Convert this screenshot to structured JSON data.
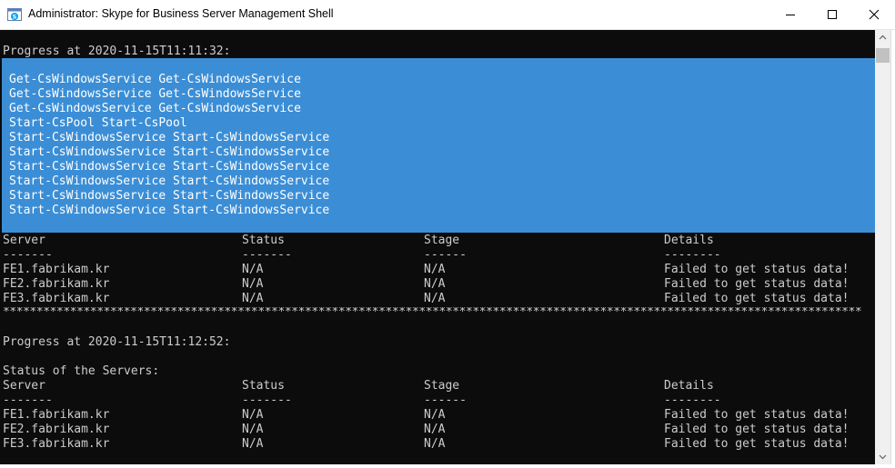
{
  "window": {
    "title": "Administrator: Skype for Business Server Management Shell",
    "icon": "skype-powershell-icon",
    "controls": {
      "minimize": "minimize-icon",
      "maximize": "maximize-icon",
      "close": "close-icon"
    }
  },
  "colors": {
    "console_bg": "#0c0c0c",
    "console_text": "#cccccc",
    "selection_bg": "#3b8ed6",
    "selection_text": "#ffffff"
  },
  "console": {
    "progress1": "Progress at 2020-11-15T11:11:32:",
    "selected_lines": [
      "Get-CsWindowsService Get-CsWindowsService",
      "Get-CsWindowsService Get-CsWindowsService",
      "Get-CsWindowsService Get-CsWindowsService",
      "Start-CsPool Start-CsPool",
      "Start-CsWindowsService Start-CsWindowsService",
      "Start-CsWindowsService Start-CsWindowsService",
      "Start-CsWindowsService Start-CsWindowsService",
      "Start-CsWindowsService Start-CsWindowsService",
      "Start-CsWindowsService Start-CsWindowsService",
      "Start-CsWindowsService Start-CsWindowsService"
    ],
    "table1": {
      "headers": [
        "Server",
        "Status",
        "Stage",
        "Details"
      ],
      "underlines": [
        "-------",
        "-------",
        "------",
        "--------"
      ],
      "rows": [
        [
          "FE1.fabrikam.kr",
          "N/A",
          "N/A",
          "Failed to get status data!"
        ],
        [
          "FE2.fabrikam.kr",
          "N/A",
          "N/A",
          "Failed to get status data!"
        ],
        [
          "FE3.fabrikam.kr",
          "N/A",
          "N/A",
          "Failed to get status data!"
        ]
      ]
    },
    "separator": "*****************************************************************************************************************************************************************",
    "progress2": "Progress at 2020-11-15T11:12:52:",
    "status_heading": "Status of the Servers:",
    "table2": {
      "headers": [
        "Server",
        "Status",
        "Stage",
        "Details"
      ],
      "underlines": [
        "-------",
        "-------",
        "------",
        "--------"
      ],
      "rows": [
        [
          "FE1.fabrikam.kr",
          "N/A",
          "N/A",
          "Failed to get status data!"
        ],
        [
          "FE2.fabrikam.kr",
          "N/A",
          "N/A",
          "Failed to get status data!"
        ],
        [
          "FE3.fabrikam.kr",
          "N/A",
          "N/A",
          "Failed to get status data!"
        ]
      ]
    }
  }
}
